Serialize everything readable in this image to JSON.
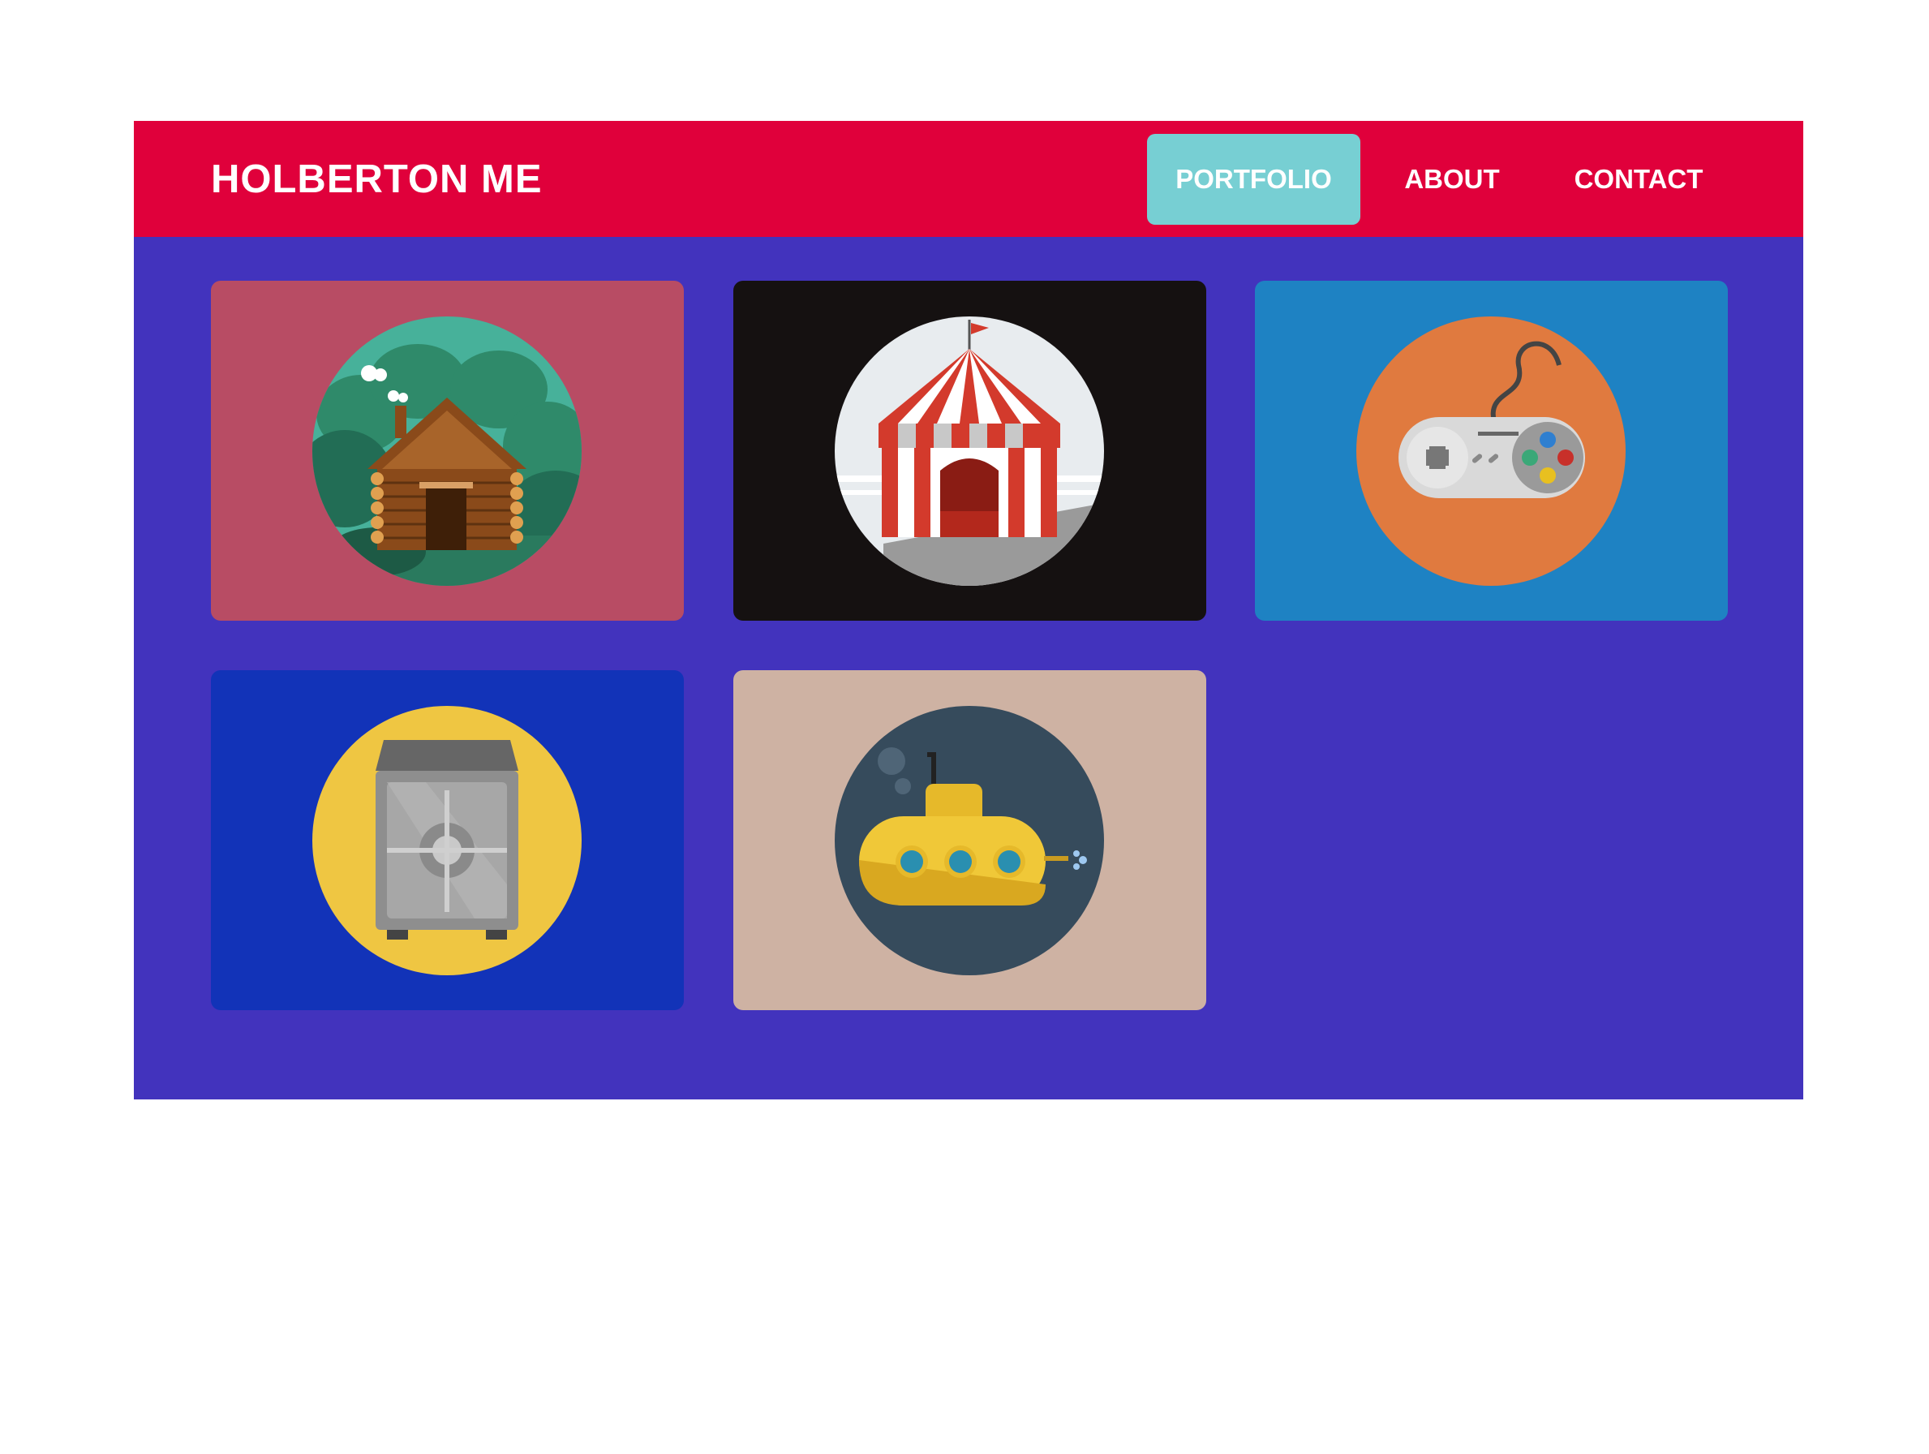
{
  "header": {
    "brand": "HOLBERTON ME",
    "nav": {
      "portfolio": "PORTFOLIO",
      "about": "ABOUT",
      "contact": "CONTACT"
    },
    "colors": {
      "bar": "#e0003b",
      "active": "#77cfd3"
    }
  },
  "portfolio": {
    "background": "#4233bd",
    "cards": [
      {
        "icon": "log-cabin-icon",
        "background": "#b84c64",
        "circle": "#47b19a"
      },
      {
        "icon": "circus-tent-icon",
        "background": "#151111",
        "circle": "#e8ecef"
      },
      {
        "icon": "game-controller-icon",
        "background": "#1e82c3",
        "circle": "#e07a3f"
      },
      {
        "icon": "safe-vault-icon",
        "background": "#1233b8",
        "circle": "#efc642"
      },
      {
        "icon": "submarine-icon",
        "background": "#ceb2a3",
        "circle": "#364b5c"
      }
    ]
  }
}
